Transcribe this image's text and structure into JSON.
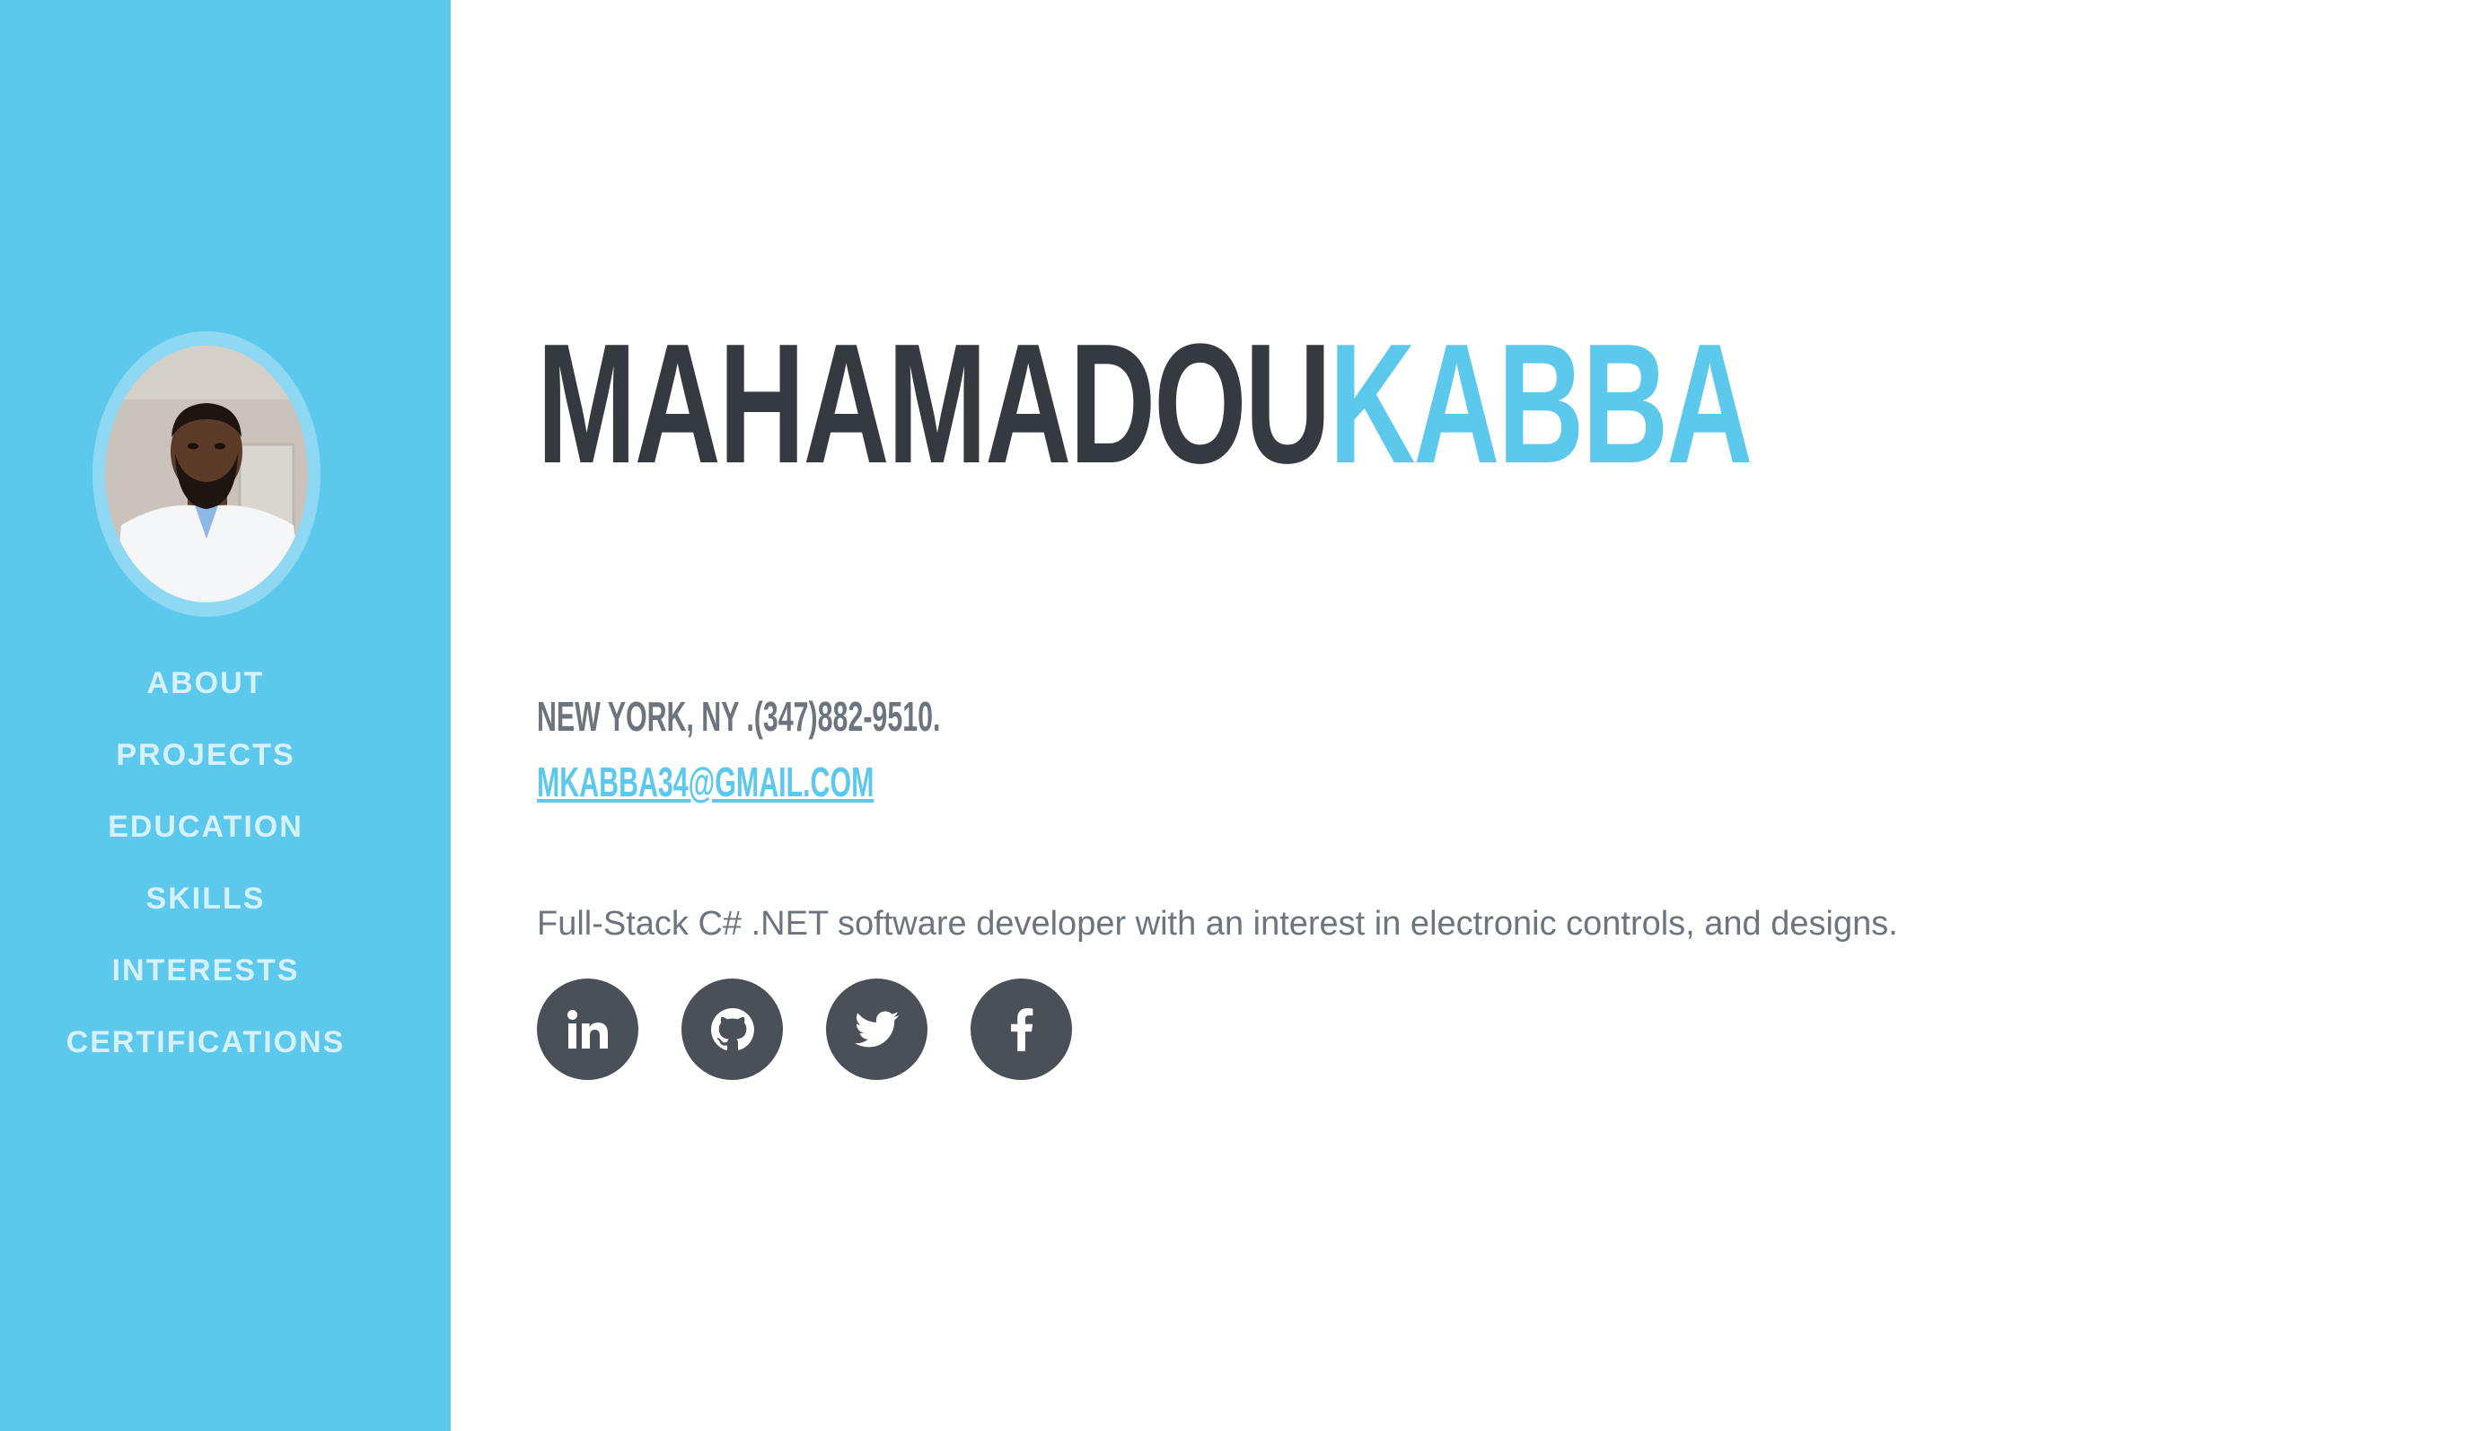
{
  "colors": {
    "sidebar": "#5cc8ec",
    "accent": "#5cc8ec",
    "heading_dark": "#343a40",
    "muted_text": "#6c757d",
    "social_button": "#495057",
    "nav_text": "#d6f1fb"
  },
  "sidebar": {
    "nav_items": [
      {
        "label": "ABOUT"
      },
      {
        "label": "PROJECTS"
      },
      {
        "label": "EDUCATION"
      },
      {
        "label": "SKILLS"
      },
      {
        "label": "INTERESTS"
      },
      {
        "label": "CERTIFICATIONS"
      }
    ]
  },
  "main": {
    "name_first": "MAHAMADOU",
    "name_last": "KABBA",
    "contact_line": "NEW YORK, NY .(347)882-9510.",
    "email": "MKABBA34@GMAIL.COM",
    "tagline": "Full-Stack C# .NET software developer with an interest in electronic controls, and designs.",
    "social": [
      {
        "icon": "linkedin-icon"
      },
      {
        "icon": "github-icon"
      },
      {
        "icon": "twitter-icon"
      },
      {
        "icon": "facebook-icon"
      }
    ]
  }
}
